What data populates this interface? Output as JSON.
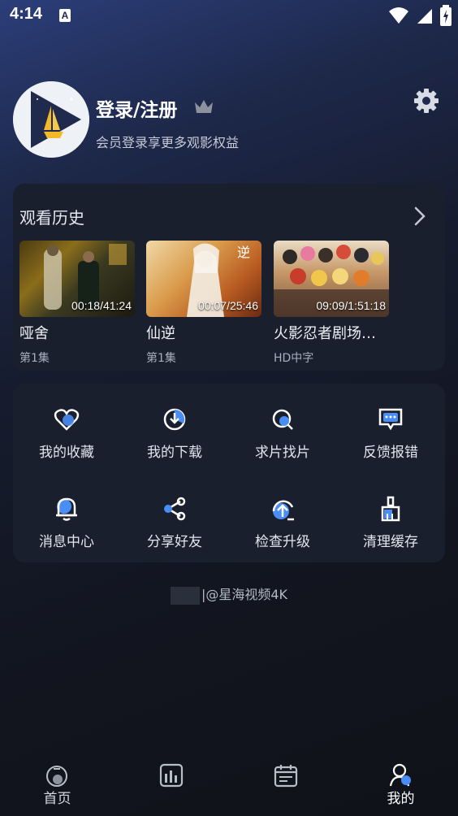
{
  "status_bar": {
    "time": "4:14",
    "notif_letter": "A"
  },
  "profile": {
    "title": "登录/注册",
    "subtitle": "会员登录享更多观影权益"
  },
  "history": {
    "title": "观看历史",
    "items": [
      {
        "name": "哑舍",
        "episode": "第1集",
        "progress": "00:18/41:24"
      },
      {
        "name": "仙逆",
        "episode": "第1集",
        "progress": "00:07/25:46"
      },
      {
        "name": "火影忍者剧场…",
        "episode": "HD中字",
        "progress": "09:09/1:51:18"
      }
    ]
  },
  "grid": [
    {
      "label": "我的收藏",
      "icon": "heart-icon"
    },
    {
      "label": "我的下载",
      "icon": "download-icon"
    },
    {
      "label": "求片找片",
      "icon": "search-movie-icon"
    },
    {
      "label": "反馈报错",
      "icon": "feedback-icon"
    },
    {
      "label": "消息中心",
      "icon": "bell-icon"
    },
    {
      "label": "分享好友",
      "icon": "share-icon"
    },
    {
      "label": "检查升级",
      "icon": "upgrade-icon"
    },
    {
      "label": "清理缓存",
      "icon": "broom-icon"
    }
  ],
  "footer_note": "|@星海视频4K",
  "bottom_nav": [
    {
      "label": "首页",
      "icon": "home-icon"
    },
    {
      "label": "",
      "icon": "chart-icon"
    },
    {
      "label": "",
      "icon": "calendar-icon"
    },
    {
      "label": "我的",
      "icon": "profile-icon"
    }
  ],
  "colors": {
    "accent": "#4a8df5",
    "card": "#1a1f2e"
  }
}
